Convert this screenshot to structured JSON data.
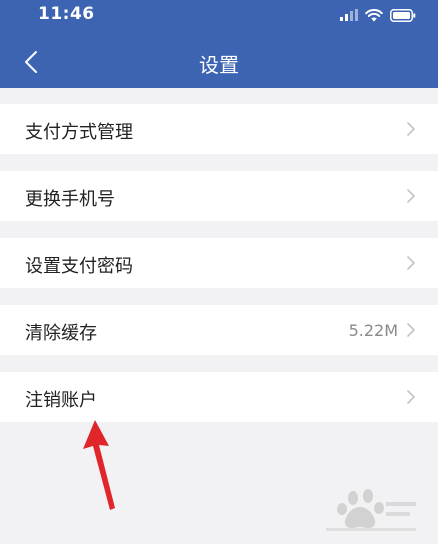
{
  "status_bar": {
    "time": "11:46",
    "icons": [
      "signal-icon",
      "wifi-icon",
      "battery-icon"
    ]
  },
  "nav": {
    "title": "设置",
    "back_icon": "chevron-left-icon"
  },
  "settings_items": [
    {
      "label": "支付方式管理",
      "value": ""
    },
    {
      "label": "更换手机号",
      "value": ""
    },
    {
      "label": "设置支付密码",
      "value": ""
    },
    {
      "label": "清除缓存",
      "value": "5.22M"
    },
    {
      "label": "注销账户",
      "value": ""
    }
  ],
  "annotation": {
    "icon": "red-arrow-icon",
    "color": "#e0262b"
  },
  "watermark": {
    "icon": "baidu-paw-logo"
  },
  "colors": {
    "header": "#3d63b3",
    "background": "#f2f2f4",
    "item_background": "#ffffff",
    "chevron": "#c4c4c4"
  }
}
